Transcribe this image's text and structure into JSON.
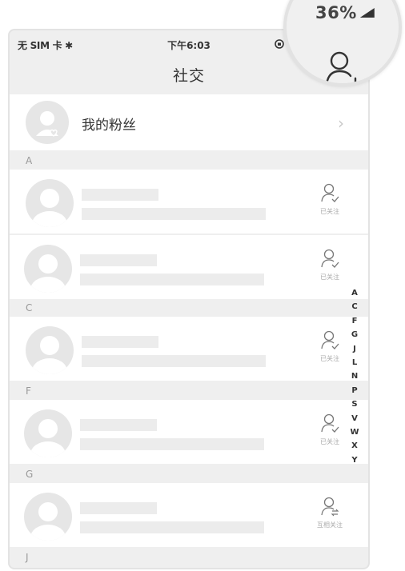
{
  "status_bar": {
    "carrier": "无 SIM 卡 ✱",
    "time": "下午6:03",
    "right_icon": "rotation-lock-icon"
  },
  "nav": {
    "title": "社交",
    "add_friend_icon": "add-user-icon"
  },
  "magnifier": {
    "battery_text": "36%"
  },
  "fans": {
    "label": "我的粉丝"
  },
  "sections": [
    {
      "letter": "A"
    },
    {
      "letter": "C"
    },
    {
      "letter": "F"
    },
    {
      "letter": "G"
    },
    {
      "letter": "J"
    }
  ],
  "contacts": [
    {
      "status_label": "已关注"
    },
    {
      "status_label": "已关注"
    },
    {
      "status_label": "已关注"
    },
    {
      "status_label": "已关注"
    },
    {
      "status_label": "互相关注"
    }
  ],
  "index_letters": [
    "A",
    "C",
    "F",
    "G",
    "J",
    "L",
    "N",
    "P",
    "S",
    "V",
    "W",
    "X",
    "Y"
  ],
  "colors": {
    "background": "#efefef",
    "row": "#ffffff",
    "placeholder": "#ececec",
    "avatar": "#e6e6e6"
  }
}
